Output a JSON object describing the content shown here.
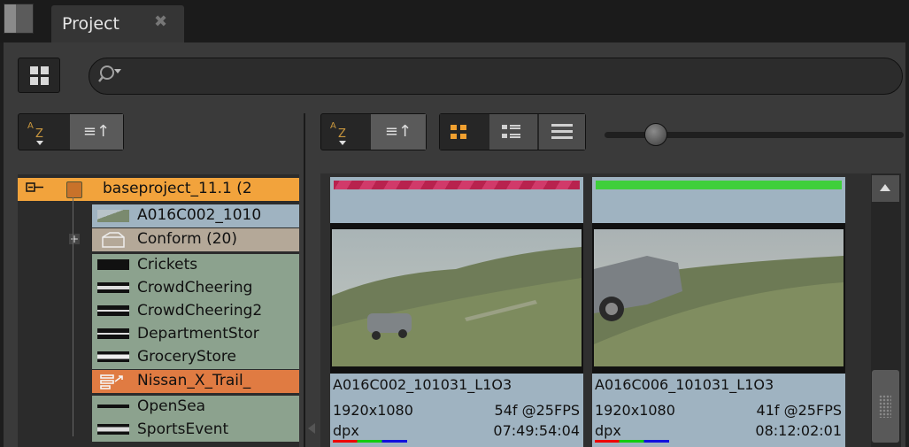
{
  "tab": {
    "label": "Project",
    "close": "✖"
  },
  "search": {
    "icon": "search-icon"
  },
  "tree": {
    "items": [
      {
        "label": "baseproject_11.1 (2",
        "style": "selected-project",
        "icon": "project-icon"
      },
      {
        "label": "A016C002_1010",
        "style": "clip",
        "icon": "clip-thumb"
      },
      {
        "label": "Conform (20)",
        "style": "bin",
        "icon": "bin-icon"
      },
      {
        "label": "Crickets",
        "style": "audio",
        "icon": "audio-waveform"
      },
      {
        "label": "CrowdCheering",
        "style": "audio",
        "icon": "audio-waveform"
      },
      {
        "label": "CrowdCheering2",
        "style": "audio",
        "icon": "audio-waveform"
      },
      {
        "label": "DepartmentStor",
        "style": "audio",
        "icon": "audio-waveform"
      },
      {
        "label": "GroceryStore",
        "style": "audio",
        "icon": "audio-waveform"
      },
      {
        "label": "Nissan_X_Trail_",
        "style": "sequence-selected",
        "icon": "sequence-icon"
      },
      {
        "label": "OpenSea",
        "style": "audio",
        "icon": "audio-waveform"
      },
      {
        "label": "SportsEvent",
        "style": "audio",
        "icon": "audio-waveform"
      }
    ]
  },
  "slider": {
    "zoom_level": 0.2
  },
  "clips": [
    {
      "name": "A016C002_101031_L1O3",
      "resolution": "1920x1080",
      "frames": "54f @25FPS",
      "format": "dpx",
      "timecode": "07:49:54:04",
      "status": "offline"
    },
    {
      "name": "A016C006_101031_L1O3",
      "resolution": "1920x1080",
      "frames": "41f @25FPS",
      "format": "dpx",
      "timecode": "08:12:02:01",
      "status": "online"
    }
  ],
  "colors": {
    "accent": "#f2a33c",
    "selected_row": "#e07b42",
    "audio_row": "#8ca28e",
    "bin_row": "#b4a898",
    "card": "#9fb3c1"
  }
}
